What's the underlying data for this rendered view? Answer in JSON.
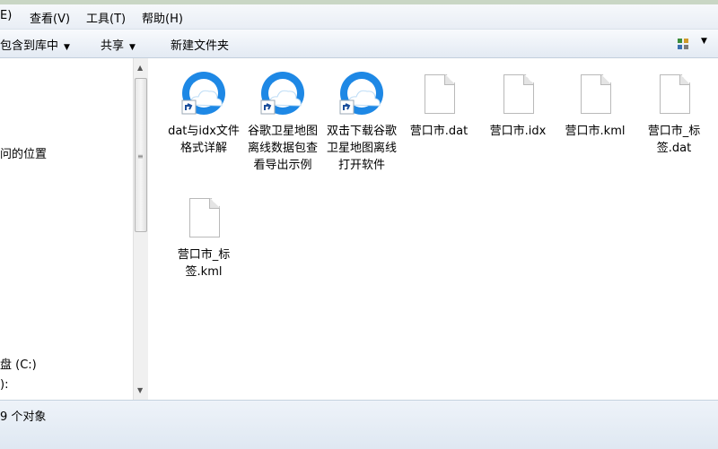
{
  "menu": {
    "edit": "E)",
    "view": "查看(V)",
    "tools": "工具(T)",
    "help": "帮助(H)"
  },
  "toolbar": {
    "include_library": "包含到库中",
    "share": "共享",
    "new_folder": "新建文件夹"
  },
  "nav": {
    "item_location": "问的位置",
    "item_disk_c": "盘 (C:)",
    "item_disk_d": "):"
  },
  "files": [
    {
      "name": "dat与idx文件格式详解",
      "icon": "shortcut-app-icon"
    },
    {
      "name": "谷歌卫星地图离线数据包查看导出示例",
      "icon": "shortcut-app-icon"
    },
    {
      "name": "双击下载谷歌卫星地图离线打开软件",
      "icon": "shortcut-app-icon"
    },
    {
      "name": "营口市.dat",
      "icon": "file-icon"
    },
    {
      "name": "营口市.idx",
      "icon": "file-icon"
    },
    {
      "name": "营口市.kml",
      "icon": "file-icon"
    },
    {
      "name": "营口市_标签.dat",
      "icon": "file-icon"
    },
    {
      "name": "营口市_标签.kml",
      "icon": "file-icon"
    }
  ],
  "status": {
    "count": "9 个对象"
  },
  "colors": {
    "app_icon_blue": "#1e88e5",
    "shortcut_arrow_bg": "#ffffff"
  }
}
